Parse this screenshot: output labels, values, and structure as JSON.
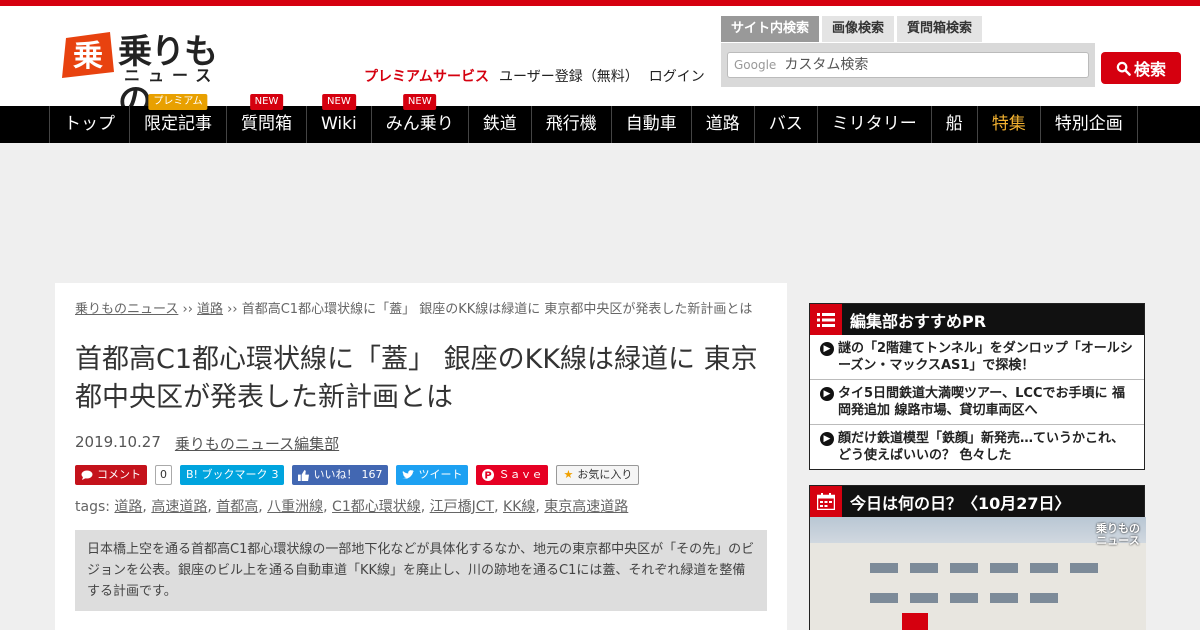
{
  "site": {
    "logo_text": "乗りもの",
    "logo_sub": "ニュース"
  },
  "header": {
    "premium": "プレミアムサービス",
    "register": "ユーザー登録（無料）",
    "login": "ログイン"
  },
  "search": {
    "tabs": [
      "サイト内検索",
      "画像検索",
      "質問箱検索"
    ],
    "google_label": "Google",
    "placeholder": "カスタム検索",
    "button": "検索"
  },
  "nav": {
    "items": [
      {
        "label": "トップ",
        "badge": ""
      },
      {
        "label": "限定記事",
        "badge": "プレミアム"
      },
      {
        "label": "質問箱",
        "badge": "NEW"
      },
      {
        "label": "Wiki",
        "badge": "NEW"
      },
      {
        "label": "みん乗り",
        "badge": "NEW"
      },
      {
        "label": "鉄道",
        "badge": ""
      },
      {
        "label": "飛行機",
        "badge": ""
      },
      {
        "label": "自動車",
        "badge": ""
      },
      {
        "label": "道路",
        "badge": ""
      },
      {
        "label": "バス",
        "badge": ""
      },
      {
        "label": "ミリタリー",
        "badge": ""
      },
      {
        "label": "船",
        "badge": ""
      },
      {
        "label": "特集",
        "badge": ""
      },
      {
        "label": "特別企画",
        "badge": ""
      }
    ]
  },
  "article": {
    "breadcrumb": {
      "home": "乗りものニュース",
      "sep": " ›› ",
      "category": "道路",
      "current": "首都高C1都心環状線に「蓋」 銀座のKK線は緑道に 東京都中央区が発表した新計画とは"
    },
    "title": "首都高C1都心環状線に「蓋」 銀座のKK線は緑道に 東京都中央区が発表した新計画とは",
    "date": "2019.10.27",
    "author": "乗りものニュース編集部",
    "social": {
      "comment": "コメント",
      "comment_count": "0",
      "hatena": "B! ブックマーク",
      "hatena_count": "3",
      "like": "いいね！",
      "like_count": "167",
      "tweet": "ツイート",
      "save": "Ｓａｖｅ",
      "fav": "お気に入り"
    },
    "tags_label": "tags:",
    "tags": [
      "道路",
      "高速道路",
      "首都高",
      "八重洲線",
      "C1都心環状線",
      "江戸橋JCT",
      "KK線",
      "東京高速道路"
    ],
    "lead": "日本橋上空を通る首都高C1都心環状線の一部地下化などが具体化するなか、地元の東京都中央区が「その先」のビジョンを公表。銀座のビル上を通る自動車道「KK線」を廃止し、川の跡地を通るC1には蓋、それぞれ緑道を整備する計画です。"
  },
  "sidebar": {
    "pr_title": "編集部おすすめPR",
    "pr_items": [
      "謎の「2階建てトンネル」をダンロップ「オールシーズン・マックスAS1」で探検！",
      "タイ5日間鉄道大満喫ツアー、LCCでお手頃に 福岡発追加 線路市場、貸切車両区へ",
      "顔だけ鉄道模型「鉄顔」新発売…ていうかこれ、どう使えばいいの？ 色々した"
    ],
    "today_title": "今日は何の日？〈10月27日〉",
    "watermark": "乗りもの\nニュース"
  },
  "colors": {
    "brand_red": "#d5000f",
    "nav_bg": "#000000",
    "special_nav": "#f0b030"
  }
}
